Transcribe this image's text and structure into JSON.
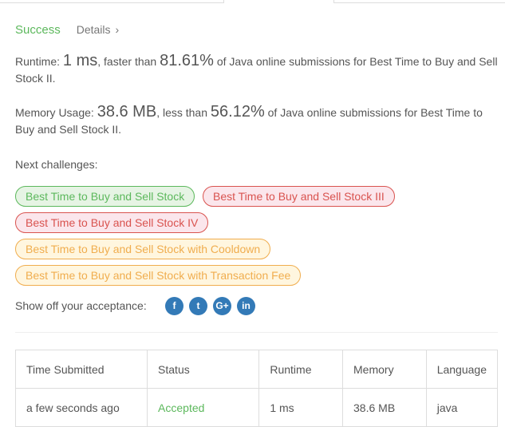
{
  "status": {
    "label": "Success",
    "details_label": "Details",
    "details_chevron": "›"
  },
  "runtime": {
    "label": "Runtime:",
    "value": "1 ms",
    "compare_text": ", faster than",
    "percent": "81.61%",
    "suffix": "of Java online submissions for Best Time to Buy and Sell Stock II."
  },
  "memory": {
    "label": "Memory Usage:",
    "value": "38.6 MB",
    "compare_text": ", less than",
    "percent": "56.12%",
    "suffix": "of Java online submissions for Best Time to Buy and Sell Stock II."
  },
  "next_challenges": {
    "label": "Next challenges:",
    "items": [
      {
        "title": "Best Time to Buy and Sell Stock",
        "difficulty": "easy"
      },
      {
        "title": "Best Time to Buy and Sell Stock III",
        "difficulty": "hard"
      },
      {
        "title": "Best Time to Buy and Sell Stock IV",
        "difficulty": "hard"
      },
      {
        "title": "Best Time to Buy and Sell Stock with Cooldown",
        "difficulty": "medium"
      },
      {
        "title": "Best Time to Buy and Sell Stock with Transaction Fee",
        "difficulty": "medium"
      }
    ]
  },
  "share": {
    "label": "Show off your acceptance:",
    "icons": [
      "facebook-icon",
      "twitter-icon",
      "google-plus-icon",
      "linkedin-icon"
    ],
    "glyphs": [
      "f",
      "t",
      "G+",
      "in"
    ]
  },
  "table": {
    "headers": [
      "Time Submitted",
      "Status",
      "Runtime",
      "Memory",
      "Language"
    ],
    "rows": [
      [
        "a few seconds ago",
        "Accepted",
        "1 ms",
        "38.6 MB",
        "java"
      ]
    ]
  },
  "colors": {
    "success": "#5cb85c",
    "hard": "#d9534f",
    "medium": "#f0ad4e",
    "share": "#337ab7"
  }
}
